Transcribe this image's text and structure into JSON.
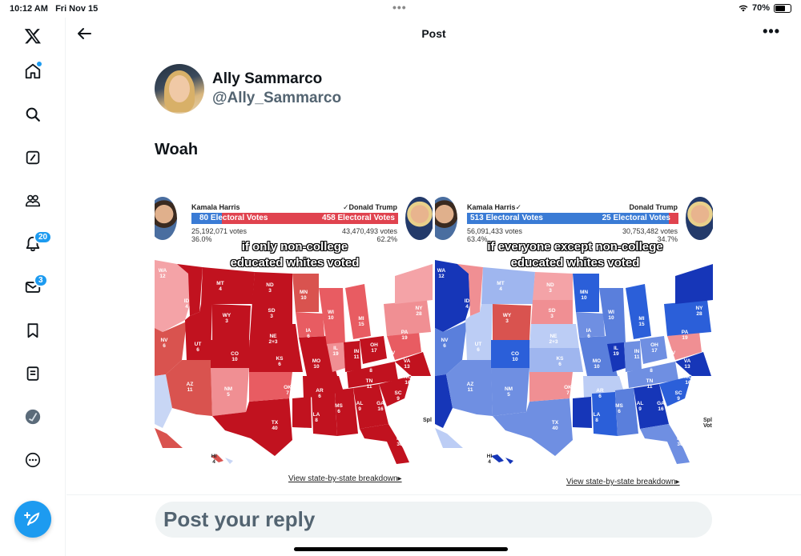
{
  "status": {
    "time": "10:12 AM",
    "date": "Fri Nov 15",
    "battery": "70%",
    "battery_level": 0.7
  },
  "header": {
    "title": "Post"
  },
  "nav": {
    "notifications_badge": "20",
    "messages_badge": "3"
  },
  "post": {
    "display_name": "Ally Sammarco",
    "handle": "@Ally_Sammarco",
    "text": "Woah"
  },
  "media": {
    "left": {
      "harris_name": "Kamala Harris",
      "trump_name": "✓Donald Trump",
      "harris_ev": "80 Electoral Votes",
      "trump_ev": "458 Electoral Votes",
      "harris_ev_share": 0.149,
      "harris_votes": "25,192,071 votes",
      "harris_pct": "36.0%",
      "trump_votes": "43,470,493 votes",
      "trump_pct": "62.2%",
      "caption_line1": "if only non-college",
      "caption_line2": "educated whites voted",
      "breakdown": "View state-by-state breakdown▸",
      "side_note": "Spl"
    },
    "right": {
      "harris_name": "Kamala Harris✓",
      "trump_name": "Donald Trump",
      "harris_ev": "513 Electoral Votes",
      "trump_ev": "25 Electoral Votes",
      "harris_ev_share": 0.954,
      "harris_votes": "56,091,433 votes",
      "harris_pct": "63.4%",
      "trump_votes": "30,753,482 votes",
      "trump_pct": "34.7%",
      "caption_line1": "if everyone except non-college",
      "caption_line2": "educated whites voted",
      "breakdown": "View state-by-state breakdown▸",
      "side_note": "Spl\nVot"
    },
    "colors": {
      "dem": "#2b5fd9",
      "rep": "#c1121f",
      "dem_bar": "#3a7bd5",
      "rep_bar": "#e0434f"
    }
  },
  "reply": {
    "placeholder": "Post your reply"
  }
}
